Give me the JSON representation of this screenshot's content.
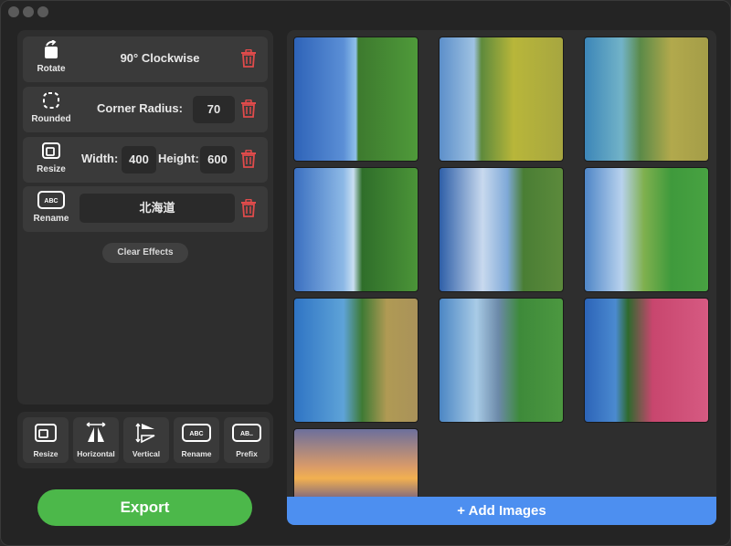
{
  "effects": [
    {
      "caption": "Rotate",
      "value": "90° Clockwise"
    },
    {
      "caption": "Rounded",
      "label": "Corner Radius:",
      "value": "70"
    },
    {
      "caption": "Resize",
      "width_label": "Width:",
      "width": "400",
      "height_label": "Height:",
      "height": "600"
    },
    {
      "caption": "Rename",
      "value": "北海道"
    }
  ],
  "clear_effects": "Clear Effects",
  "tools": [
    {
      "caption": "Resize",
      "icon": "resize-icon"
    },
    {
      "caption": "Horizontal",
      "icon": "flip-horizontal-icon"
    },
    {
      "caption": "Vertical",
      "icon": "flip-vertical-icon"
    },
    {
      "caption": "Rename",
      "icon": "rename-icon"
    },
    {
      "caption": "Prefix",
      "icon": "prefix-icon"
    }
  ],
  "export_label": "Export",
  "add_images_label": "+ Add Images",
  "colors": {
    "accent_blue": "#4d8ff0",
    "export_green": "#4cb84a",
    "trash_red": "#e04b4b"
  }
}
